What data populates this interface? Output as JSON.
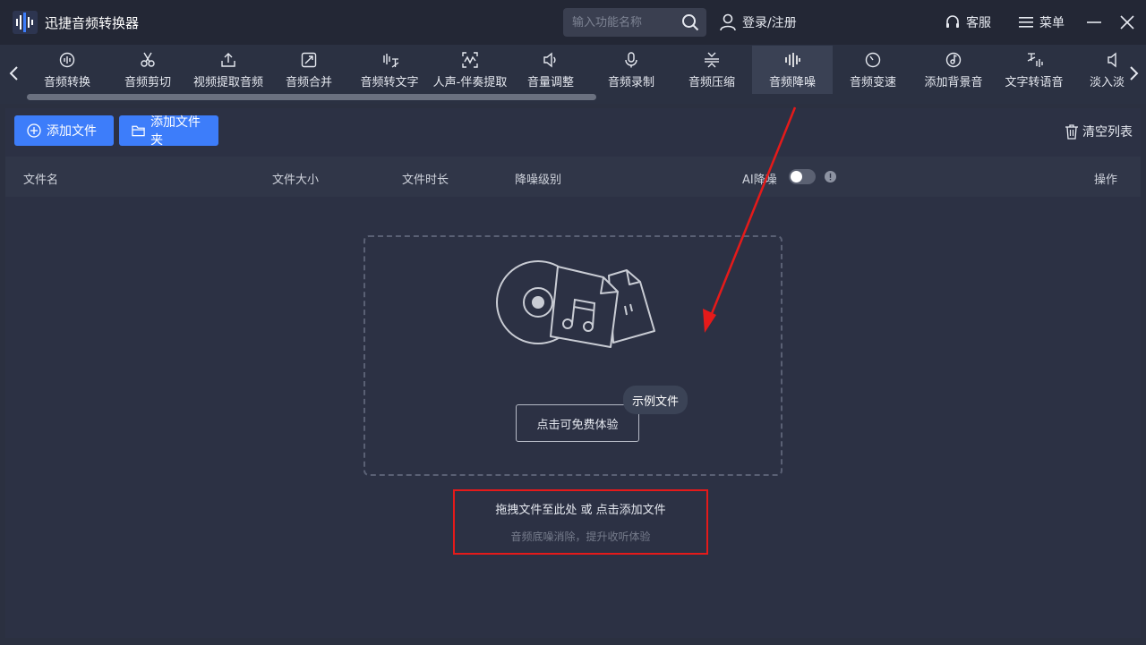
{
  "app": {
    "title": "迅捷音频转换器"
  },
  "search": {
    "placeholder": "输入功能名称"
  },
  "titlebar": {
    "login": "登录/注册",
    "service": "客服",
    "menu": "菜单"
  },
  "tools": [
    {
      "label": "音频转换",
      "icon": "audio-convert-icon"
    },
    {
      "label": "音频剪切",
      "icon": "scissors-icon"
    },
    {
      "label": "视频提取音频",
      "icon": "upload-icon"
    },
    {
      "label": "音频合并",
      "icon": "merge-icon"
    },
    {
      "label": "音频转文字",
      "icon": "audio-to-text-icon"
    },
    {
      "label": "人声-伴奏提取",
      "icon": "waveform-icon"
    },
    {
      "label": "音量调整",
      "icon": "volume-icon"
    },
    {
      "label": "音频录制",
      "icon": "microphone-icon"
    },
    {
      "label": "音频压缩",
      "icon": "compress-icon"
    },
    {
      "label": "音频降噪",
      "icon": "denoise-icon"
    },
    {
      "label": "音频变速",
      "icon": "speed-icon"
    },
    {
      "label": "添加背景音",
      "icon": "background-music-icon"
    },
    {
      "label": "文字转语音",
      "icon": "text-to-speech-icon"
    },
    {
      "label": "淡入淡",
      "icon": "fade-icon"
    }
  ],
  "active_tool": "音频降噪",
  "actions": {
    "add_file": "添加文件",
    "add_folder": "添加文件夹",
    "clear_list": "清空列表"
  },
  "table": {
    "col_name": "文件名",
    "col_size": "文件大小",
    "col_duration": "文件时长",
    "col_level": "降噪级别",
    "ai_label": "AI降噪",
    "ai_enabled": false,
    "col_ops": "操作"
  },
  "dropzone": {
    "try_button": "点击可免费体验",
    "sample_tag": "示例文件",
    "hint_main": "拖拽文件至此处 或 点击添加文件",
    "hint_sub": "音频底噪消除，提升收听体验"
  },
  "colors": {
    "accent": "#3d7dfa",
    "annotation": "#e51a1a",
    "background": "#2b3040"
  }
}
